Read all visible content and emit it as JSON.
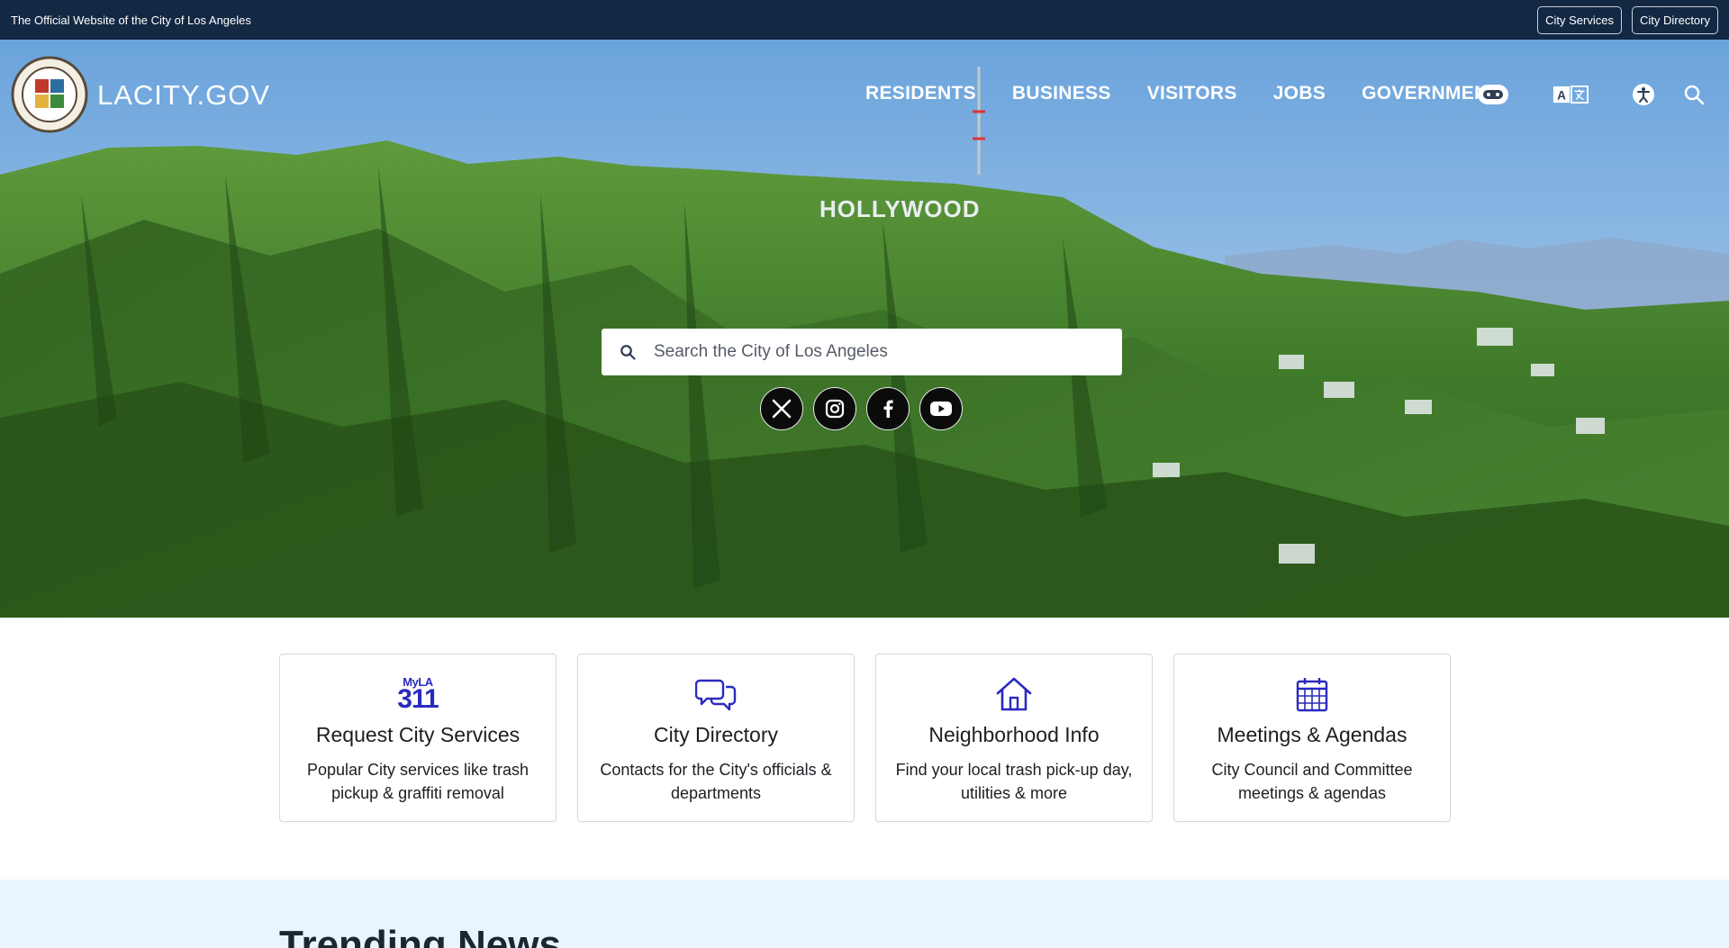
{
  "topbar": {
    "official_text": "The Official Website of the City of Los Angeles",
    "links": [
      "City Services",
      "City Directory"
    ]
  },
  "header": {
    "brand": "LACITY.GOV",
    "nav": [
      "RESIDENTS",
      "BUSINESS",
      "VISITORS",
      "JOBS",
      "GOVERNMENT"
    ],
    "icons": [
      "chatbot-icon",
      "translate-icon",
      "accessibility-icon",
      "search-icon"
    ]
  },
  "hero": {
    "sign_text": "HOLLYWOOD",
    "search_placeholder": "Search the City of Los Angeles",
    "social": [
      "x-icon",
      "instagram-icon",
      "facebook-icon",
      "youtube-icon"
    ]
  },
  "cards": [
    {
      "icon": "myla311-logo",
      "logo_top": "MyLA",
      "logo_bottom": "311",
      "title": "Request City Services",
      "desc": "Popular City services like trash pickup & graffiti removal"
    },
    {
      "icon": "chat-bubbles-icon",
      "title": "City Directory",
      "desc": "Contacts for the City's officials & departments"
    },
    {
      "icon": "house-icon",
      "title": "Neighborhood Info",
      "desc": "Find your local trash pick-up day, utilities & more"
    },
    {
      "icon": "calendar-icon",
      "title": "Meetings & Agendas",
      "desc": "City Council and Committee meetings & agendas"
    }
  ],
  "trending": {
    "heading": "Trending News"
  },
  "colors": {
    "topbar": "#132843",
    "accent": "#2a2abf",
    "trending_bg": "#e9f4fd"
  }
}
